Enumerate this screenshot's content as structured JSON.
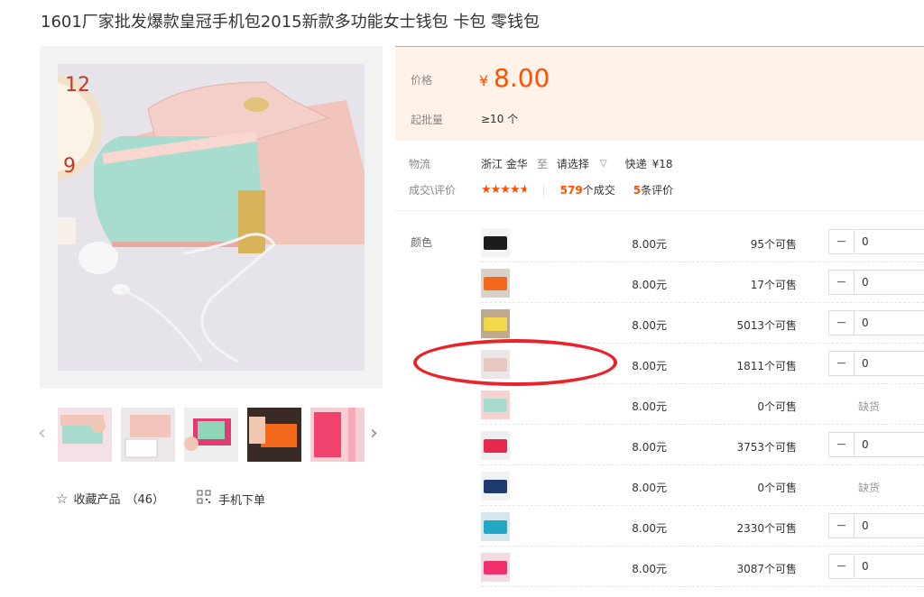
{
  "title": "1601厂家批发爆款皇冠手机包2015新款多功能女士钱包 卡包 零钱包",
  "gallery": {
    "prev_icon": "chevron-left-icon",
    "next_icon": "chevron-right-icon",
    "favorite_label": "收藏产品",
    "favorite_count": "（46）",
    "mobile_label": "手机下单"
  },
  "price": {
    "price_label": "价格",
    "currency": "¥",
    "value": "8.00",
    "moq_label": "起批量",
    "moq_value": "≥10 个"
  },
  "shipping": {
    "label": "物流",
    "origin": "浙江 金华",
    "to": "至",
    "dest": "请选择",
    "method": "快递",
    "fee": "¥18"
  },
  "deals": {
    "label": "成交\\评价",
    "rating": 4.5,
    "deal_count": "579",
    "deal_suffix": "个成交",
    "review_count": "5",
    "review_suffix": "条评价"
  },
  "sku": {
    "label": "颜色",
    "rows": [
      {
        "price": "8.00元",
        "stock": "95个可售",
        "qty": "0",
        "available": true
      },
      {
        "price": "8.00元",
        "stock": "17个可售",
        "qty": "0",
        "available": true
      },
      {
        "price": "8.00元",
        "stock": "5013个可售",
        "qty": "0",
        "available": true
      },
      {
        "price": "8.00元",
        "stock": "1811个可售",
        "qty": "0",
        "available": true
      },
      {
        "price": "8.00元",
        "stock": "0个可售",
        "soldout": "缺货",
        "available": false
      },
      {
        "price": "8.00元",
        "stock": "3753个可售",
        "qty": "0",
        "available": true
      },
      {
        "price": "8.00元",
        "stock": "0个可售",
        "soldout": "缺货",
        "available": false
      },
      {
        "price": "8.00元",
        "stock": "2330个可售",
        "qty": "0",
        "available": true
      },
      {
        "price": "8.00元",
        "stock": "3087个可售",
        "qty": "0",
        "available": true
      }
    ]
  },
  "colors": {
    "accent": "#ff5000",
    "annotation_red": "#e8242a"
  }
}
